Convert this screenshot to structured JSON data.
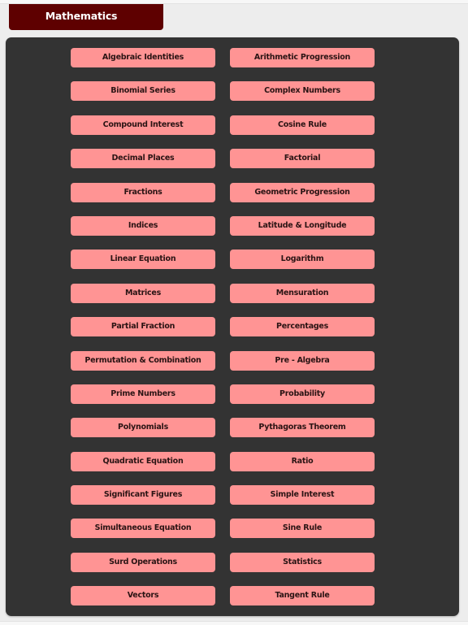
{
  "header": {
    "title": "Mathematics"
  },
  "topics": [
    {
      "label": "Algebraic Identities"
    },
    {
      "label": "Arithmetic Progression"
    },
    {
      "label": "Binomial Series"
    },
    {
      "label": "Complex Numbers"
    },
    {
      "label": "Compound Interest"
    },
    {
      "label": "Cosine Rule"
    },
    {
      "label": "Decimal Places"
    },
    {
      "label": "Factorial"
    },
    {
      "label": "Fractions"
    },
    {
      "label": "Geometric Progression"
    },
    {
      "label": "Indices"
    },
    {
      "label": "Latitude & Longitude"
    },
    {
      "label": "Linear Equation"
    },
    {
      "label": "Logarithm"
    },
    {
      "label": "Matrices"
    },
    {
      "label": "Mensuration"
    },
    {
      "label": "Partial Fraction"
    },
    {
      "label": "Percentages"
    },
    {
      "label": "Permutation & Combination"
    },
    {
      "label": "Pre - Algebra"
    },
    {
      "label": "Prime Numbers"
    },
    {
      "label": "Probability"
    },
    {
      "label": "Polynomials"
    },
    {
      "label": "Pythagoras Theorem"
    },
    {
      "label": "Quadratic Equation"
    },
    {
      "label": "Ratio"
    },
    {
      "label": "Significant Figures"
    },
    {
      "label": "Simple Interest"
    },
    {
      "label": "Simultaneous Equation"
    },
    {
      "label": "Sine Rule"
    },
    {
      "label": "Surd Operations"
    },
    {
      "label": "Statistics"
    },
    {
      "label": "Vectors"
    },
    {
      "label": "Tangent Rule"
    }
  ],
  "colors": {
    "title_background": "#5e0000",
    "panel_background": "#333333",
    "button_background": "#ff9494",
    "button_text": "#2a1414"
  }
}
